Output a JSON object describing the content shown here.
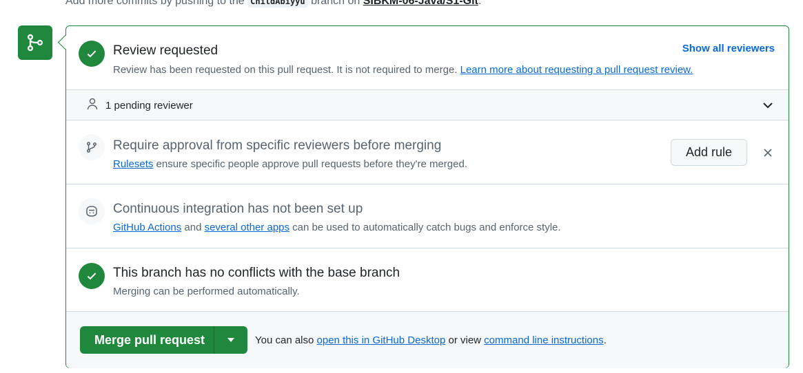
{
  "top_line": {
    "prefix": "Add more commits by pushing to the",
    "branch": "ChildAbiyyu",
    "middle": "branch on",
    "repo": "SIBKM-06-Java/S1-Git",
    "suffix": "."
  },
  "review": {
    "title": "Review requested",
    "show_all": "Show all reviewers",
    "desc_text": "Review has been requested on this pull request. It is not required to merge.",
    "desc_link": "Learn more about requesting a pull request review."
  },
  "pending": {
    "label": "1 pending reviewer"
  },
  "approval": {
    "title": "Require approval from specific reviewers before merging",
    "desc_link": "Rulesets",
    "desc_text": "ensure specific people approve pull requests before they're merged.",
    "add_rule": "Add rule"
  },
  "ci": {
    "title": "Continuous integration has not been set up",
    "link1": "GitHub Actions",
    "and_text": "and",
    "link2": "several other apps",
    "desc_text": "can be used to automatically catch bugs and enforce style."
  },
  "conflicts": {
    "title": "This branch has no conflicts with the base branch",
    "desc": "Merging can be performed automatically."
  },
  "merge": {
    "button_label": "Merge pull request",
    "text1": "You can also",
    "link1": "open this in GitHub Desktop",
    "text2": "or view",
    "link2": "command line instructions",
    "text3": "."
  },
  "colors": {
    "success": "#1f883d",
    "link": "#0969da",
    "muted": "#59636e"
  },
  "icons": [
    "git-merge-icon",
    "check-icon",
    "person-icon",
    "chevron-down-icon",
    "git-branch-icon",
    "close-icon",
    "copilot-icon"
  ]
}
